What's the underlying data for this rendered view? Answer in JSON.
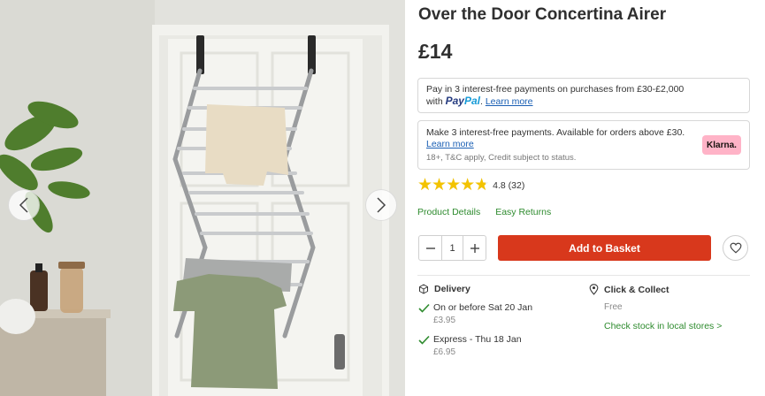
{
  "gallery": {
    "prev_icon": "chevron-left-icon",
    "next_icon": "chevron-right-icon"
  },
  "product": {
    "title": "Over the Door Concertina Airer",
    "price": "£14"
  },
  "paypal": {
    "line1": "Pay in 3 interest-free payments on purchases from £30-£2,000",
    "line2_prefix": "with",
    "brand_pay": "Pay",
    "brand_pal": "Pal",
    "learn_more": "Learn more"
  },
  "klarna": {
    "line1": "Make 3 interest-free payments. Available for orders above £30.",
    "learn_more": "Learn more",
    "terms": "18+, T&C apply, Credit subject to status.",
    "badge": "Klarna."
  },
  "rating": {
    "value": 4.8,
    "max": 5,
    "text": "4.8 (32)",
    "star_color": "#f3c300"
  },
  "links": {
    "details": "Product Details",
    "returns": "Easy Returns"
  },
  "basket": {
    "quantity": "1",
    "minus": "−",
    "plus": "+",
    "add_label": "Add to Basket",
    "add_color": "#d8381c"
  },
  "delivery": {
    "heading": "Delivery",
    "options": [
      {
        "title": "On or before Sat 20 Jan",
        "price": "£3.95"
      },
      {
        "title": "Express - Thu 18 Jan",
        "price": "£6.95"
      }
    ]
  },
  "collect": {
    "heading": "Click & Collect",
    "price": "Free",
    "link": "Check stock in local stores >"
  },
  "colors": {
    "link_green": "#2e8b2e",
    "klarna_pink": "#ffb3c7"
  }
}
